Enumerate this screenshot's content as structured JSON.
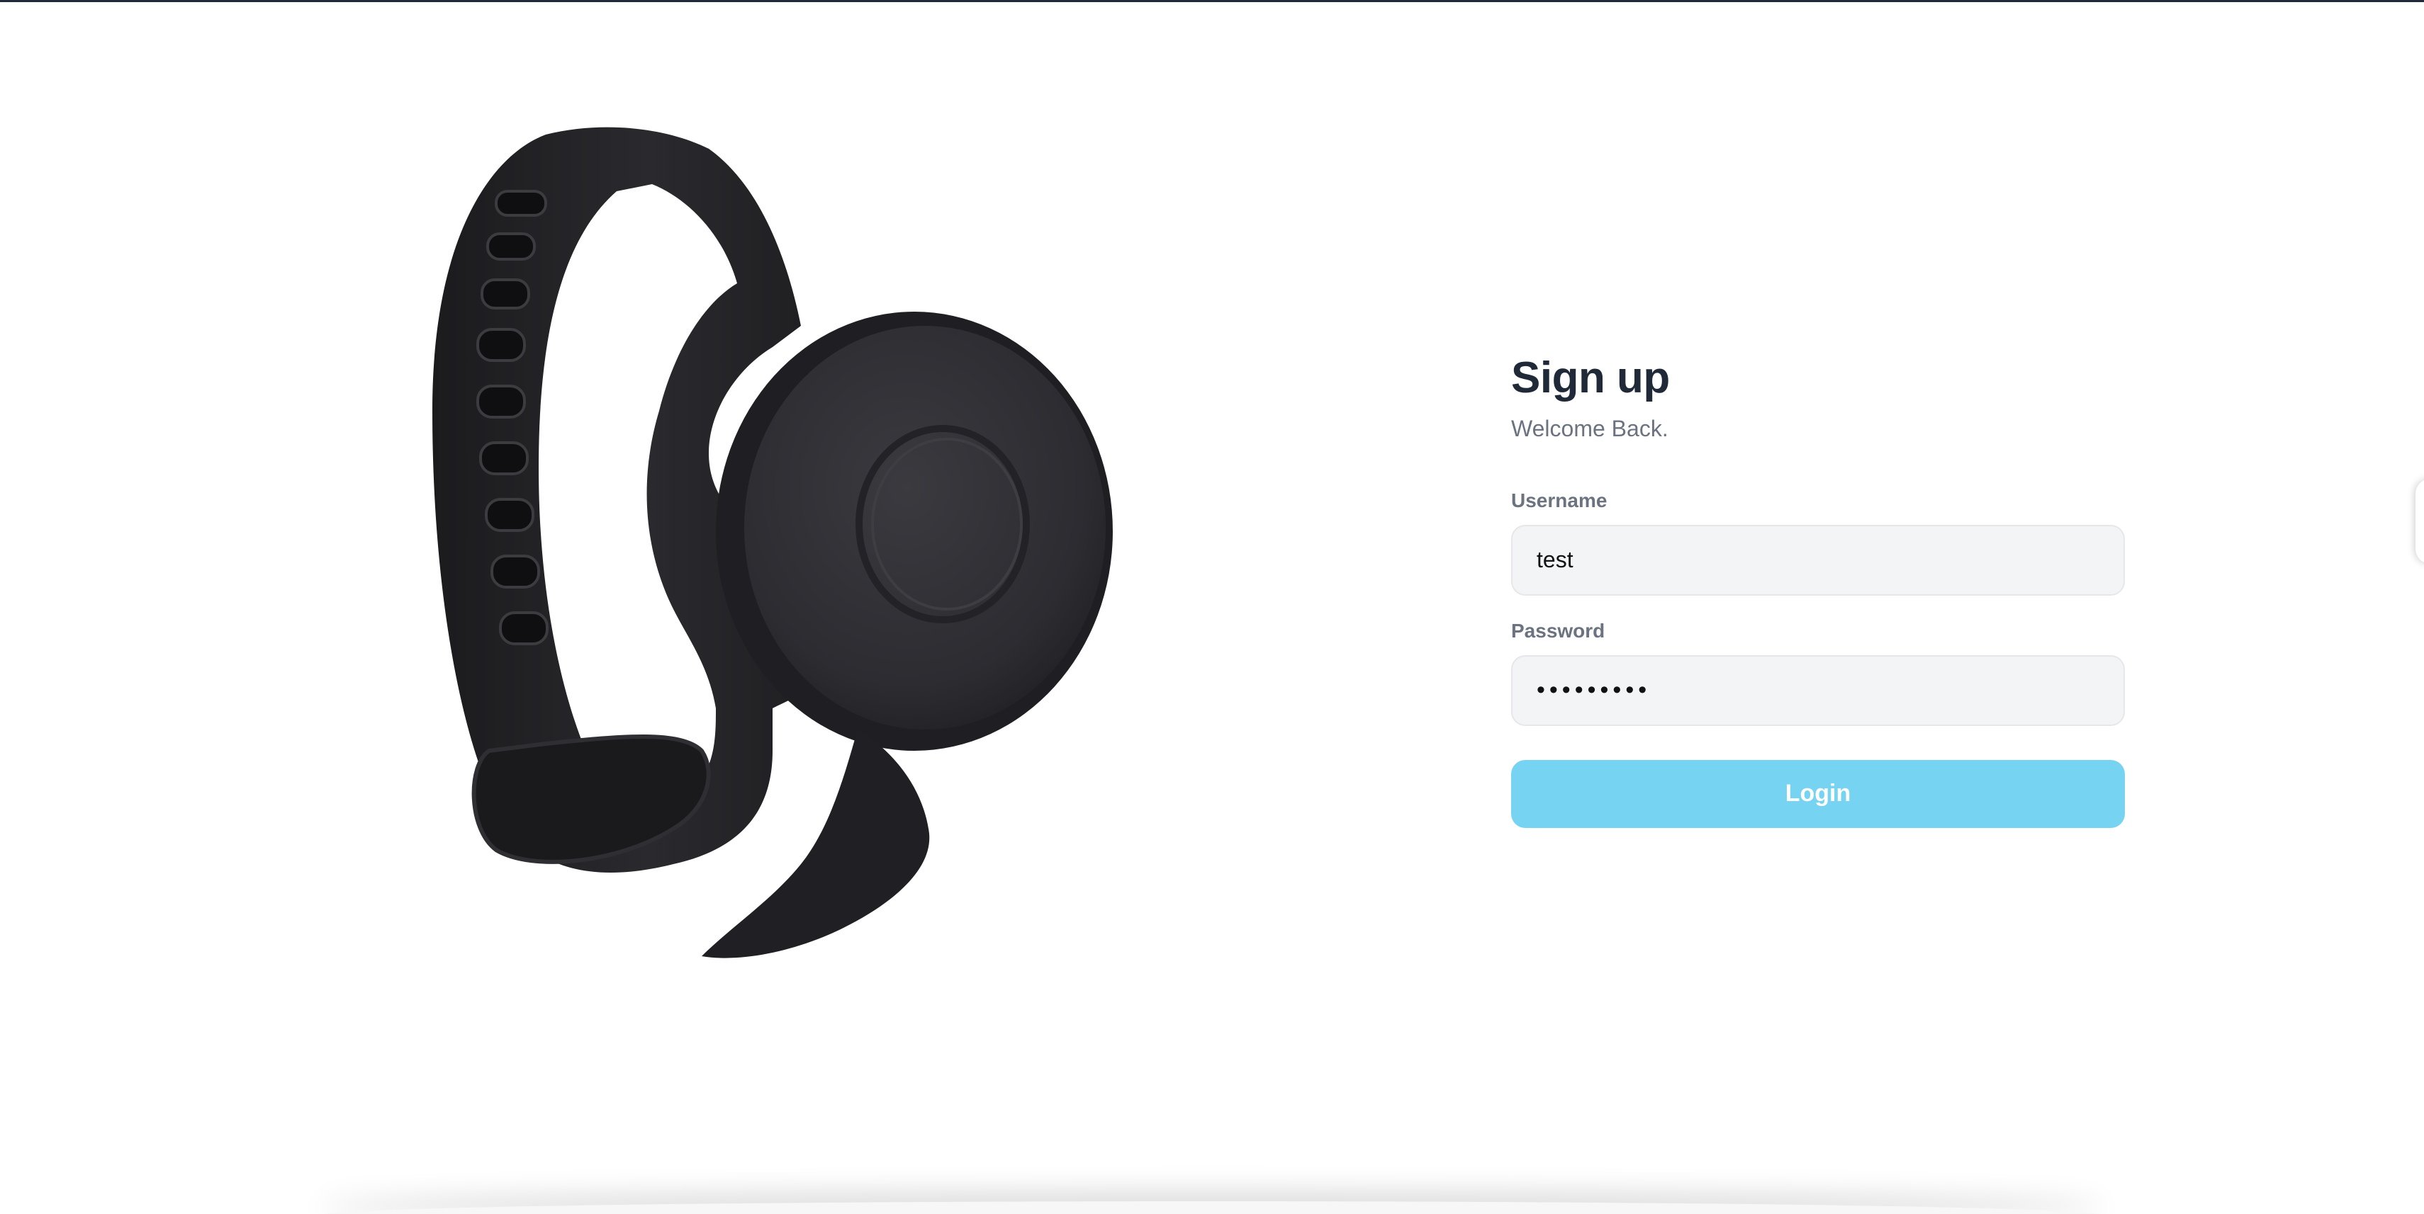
{
  "form": {
    "title": "Sign up",
    "subtitle": "Welcome Back.",
    "username": {
      "label": "Username",
      "value": "test"
    },
    "password": {
      "label": "Password",
      "value": "•••••••••"
    },
    "login_label": "Login"
  },
  "image": {
    "icon": "wristband-product-image"
  },
  "colors": {
    "title": "#1f2937",
    "subtitle": "#6b7280",
    "input_bg": "#f3f4f6",
    "button_bg": "#76d3f2",
    "button_text": "#ffffff"
  }
}
